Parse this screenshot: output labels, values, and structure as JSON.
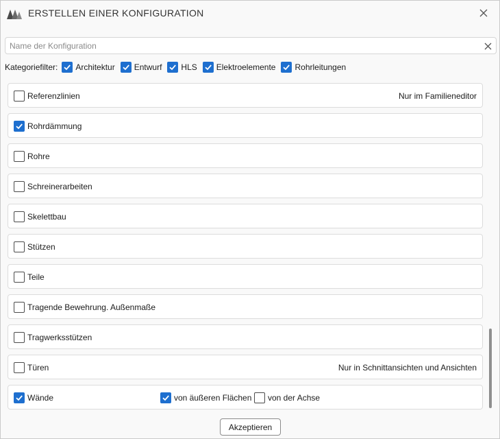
{
  "dialog": {
    "title": "ERSTELLEN EINER KONFIGURATION",
    "logo": "company-logo",
    "accent": "#1e6fcf"
  },
  "search": {
    "placeholder": "Name der Konfiguration",
    "value": ""
  },
  "filter": {
    "label": "Kategoriefilter:",
    "items": [
      {
        "label": "Architektur",
        "checked": true
      },
      {
        "label": "Entwurf",
        "checked": true
      },
      {
        "label": "HLS",
        "checked": true
      },
      {
        "label": "Elektroelemente",
        "checked": true
      },
      {
        "label": "Rohrleitungen",
        "checked": true
      }
    ]
  },
  "rows": [
    {
      "name": "Referenzlinien",
      "checked": false,
      "note": "Nur im Familieneditor"
    },
    {
      "name": "Rohrdämmung",
      "checked": true,
      "note": ""
    },
    {
      "name": "Rohre",
      "checked": false,
      "note": ""
    },
    {
      "name": "Schreinerarbeiten",
      "checked": false,
      "note": ""
    },
    {
      "name": "Skelettbau",
      "checked": false,
      "note": ""
    },
    {
      "name": "Stützen",
      "checked": false,
      "note": ""
    },
    {
      "name": "Teile",
      "checked": false,
      "note": ""
    },
    {
      "name": "Tragende Bewehrung. Außenmaße",
      "checked": false,
      "note": ""
    },
    {
      "name": "Tragwerksstützen",
      "checked": false,
      "note": ""
    },
    {
      "name": "Türen",
      "checked": false,
      "note": "Nur in Schnittansichten und Ansichten"
    },
    {
      "name": "Wände",
      "checked": true,
      "note": "",
      "options": [
        {
          "label": "von äußeren Flächen",
          "checked": true
        },
        {
          "label": "von der Achse",
          "checked": false
        }
      ]
    }
  ],
  "footer": {
    "accept_label": "Akzeptieren"
  }
}
